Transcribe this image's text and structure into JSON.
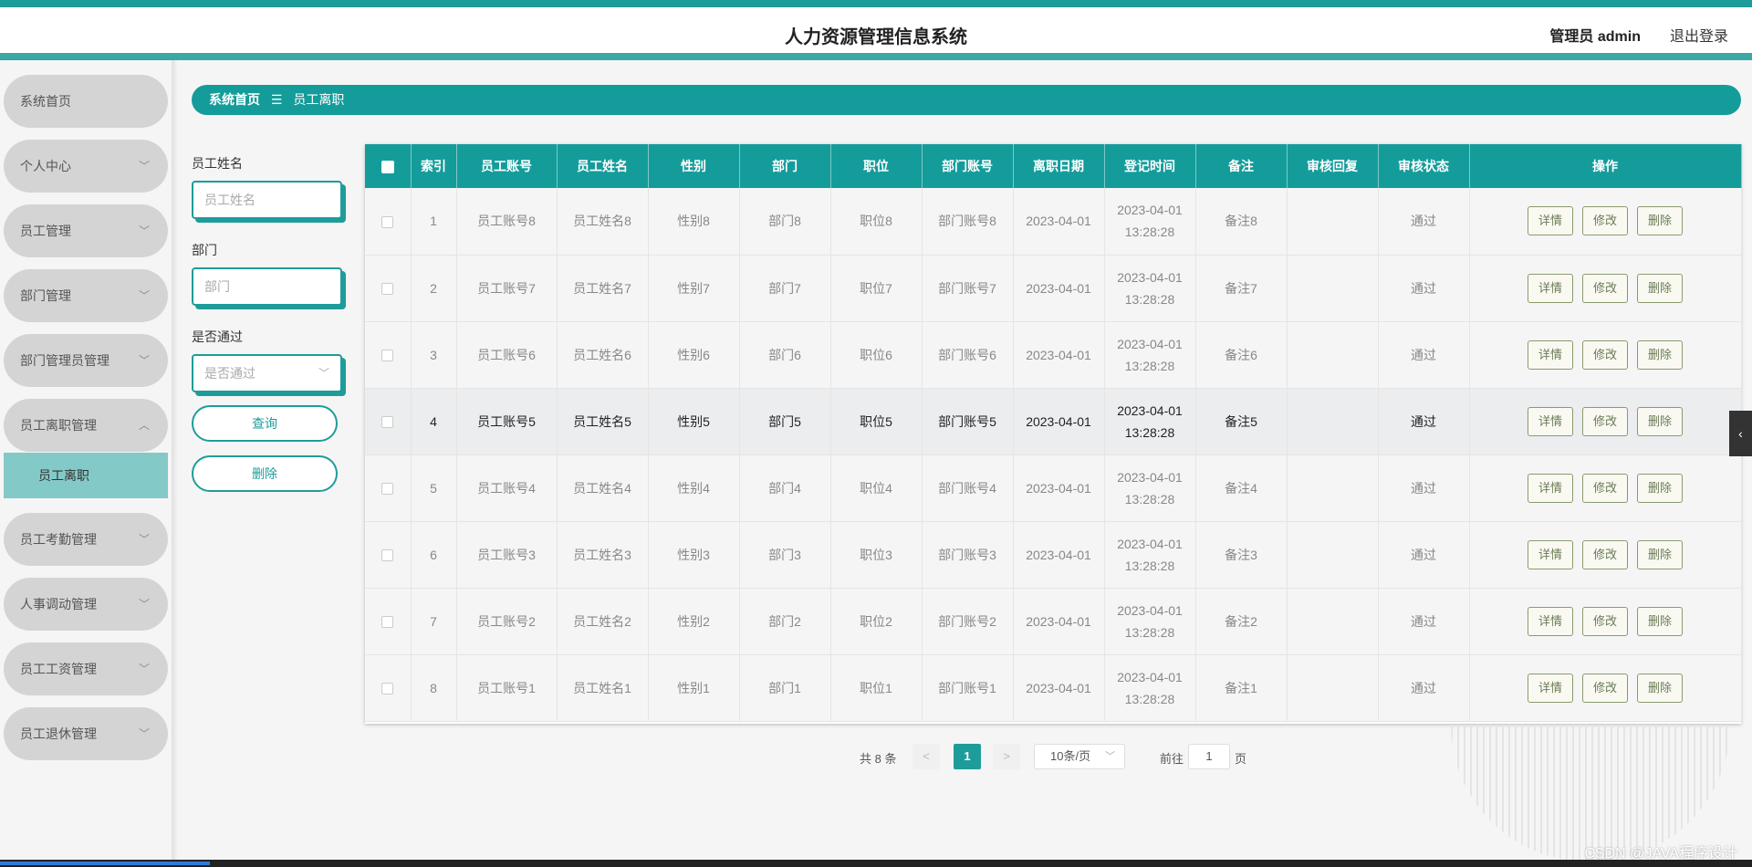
{
  "header": {
    "title": "人力资源管理信息系统",
    "user": "管理员 admin",
    "logout": "退出登录"
  },
  "sidebar": {
    "items": [
      {
        "label": "系统首页",
        "has_chevron": false
      },
      {
        "label": "个人中心",
        "has_chevron": true
      },
      {
        "label": "员工管理",
        "has_chevron": true
      },
      {
        "label": "部门管理",
        "has_chevron": true
      },
      {
        "label": "部门管理员管理",
        "has_chevron": true
      },
      {
        "label": "员工离职管理",
        "has_chevron": true,
        "expanded": true
      },
      {
        "label": "员工考勤管理",
        "has_chevron": true
      },
      {
        "label": "人事调动管理",
        "has_chevron": true
      },
      {
        "label": "员工工资管理",
        "has_chevron": true
      },
      {
        "label": "员工退休管理",
        "has_chevron": true
      }
    ],
    "sub_active": "员工离职"
  },
  "breadcrumb": {
    "home": "系统首页",
    "separator": "☰",
    "current": "员工离职"
  },
  "filters": {
    "name_label": "员工姓名",
    "name_placeholder": "员工姓名",
    "dept_label": "部门",
    "dept_placeholder": "部门",
    "pass_label": "是否通过",
    "pass_placeholder": "是否通过",
    "search_button": "查询",
    "delete_button": "删除"
  },
  "table": {
    "columns": [
      "索引",
      "员工账号",
      "员工姓名",
      "性别",
      "部门",
      "职位",
      "部门账号",
      "离职日期",
      "登记时间",
      "备注",
      "审核回复",
      "审核状态",
      "操作"
    ],
    "rows": [
      {
        "index": "1",
        "account": "员工账号8",
        "name": "员工姓名8",
        "gender": "性别8",
        "dept": "部门8",
        "position": "职位8",
        "dept_account": "部门账号8",
        "leave_date": "2023-04-01",
        "reg_date": "2023-04-01",
        "reg_time": "13:28:28",
        "remark": "备注8",
        "reply": "",
        "status": "通过"
      },
      {
        "index": "2",
        "account": "员工账号7",
        "name": "员工姓名7",
        "gender": "性别7",
        "dept": "部门7",
        "position": "职位7",
        "dept_account": "部门账号7",
        "leave_date": "2023-04-01",
        "reg_date": "2023-04-01",
        "reg_time": "13:28:28",
        "remark": "备注7",
        "reply": "",
        "status": "通过"
      },
      {
        "index": "3",
        "account": "员工账号6",
        "name": "员工姓名6",
        "gender": "性别6",
        "dept": "部门6",
        "position": "职位6",
        "dept_account": "部门账号6",
        "leave_date": "2023-04-01",
        "reg_date": "2023-04-01",
        "reg_time": "13:28:28",
        "remark": "备注6",
        "reply": "",
        "status": "通过"
      },
      {
        "index": "4",
        "account": "员工账号5",
        "name": "员工姓名5",
        "gender": "性别5",
        "dept": "部门5",
        "position": "职位5",
        "dept_account": "部门账号5",
        "leave_date": "2023-04-01",
        "reg_date": "2023-04-01",
        "reg_time": "13:28:28",
        "remark": "备注5",
        "reply": "",
        "status": "通过",
        "highlighted": true
      },
      {
        "index": "5",
        "account": "员工账号4",
        "name": "员工姓名4",
        "gender": "性别4",
        "dept": "部门4",
        "position": "职位4",
        "dept_account": "部门账号4",
        "leave_date": "2023-04-01",
        "reg_date": "2023-04-01",
        "reg_time": "13:28:28",
        "remark": "备注4",
        "reply": "",
        "status": "通过"
      },
      {
        "index": "6",
        "account": "员工账号3",
        "name": "员工姓名3",
        "gender": "性别3",
        "dept": "部门3",
        "position": "职位3",
        "dept_account": "部门账号3",
        "leave_date": "2023-04-01",
        "reg_date": "2023-04-01",
        "reg_time": "13:28:28",
        "remark": "备注3",
        "reply": "",
        "status": "通过"
      },
      {
        "index": "7",
        "account": "员工账号2",
        "name": "员工姓名2",
        "gender": "性别2",
        "dept": "部门2",
        "position": "职位2",
        "dept_account": "部门账号2",
        "leave_date": "2023-04-01",
        "reg_date": "2023-04-01",
        "reg_time": "13:28:28",
        "remark": "备注2",
        "reply": "",
        "status": "通过"
      },
      {
        "index": "8",
        "account": "员工账号1",
        "name": "员工姓名1",
        "gender": "性别1",
        "dept": "部门1",
        "position": "职位1",
        "dept_account": "部门账号1",
        "leave_date": "2023-04-01",
        "reg_date": "2023-04-01",
        "reg_time": "13:28:28",
        "remark": "备注1",
        "reply": "",
        "status": "通过"
      }
    ],
    "actions": {
      "detail": "详情",
      "edit": "修改",
      "delete": "删除"
    }
  },
  "pagination": {
    "total": "共 8 条",
    "prev": "<",
    "current_page": "1",
    "next": ">",
    "page_size": "10条/页",
    "goto_label": "前往",
    "goto_value": "1",
    "goto_unit": "页"
  },
  "side_tab": "‹",
  "watermark": "CSDN @JAVA程序设计",
  "colors": {
    "accent": "#149c9b",
    "highlight_row": "#ebedef",
    "submenu_active": "#83c9c7"
  }
}
